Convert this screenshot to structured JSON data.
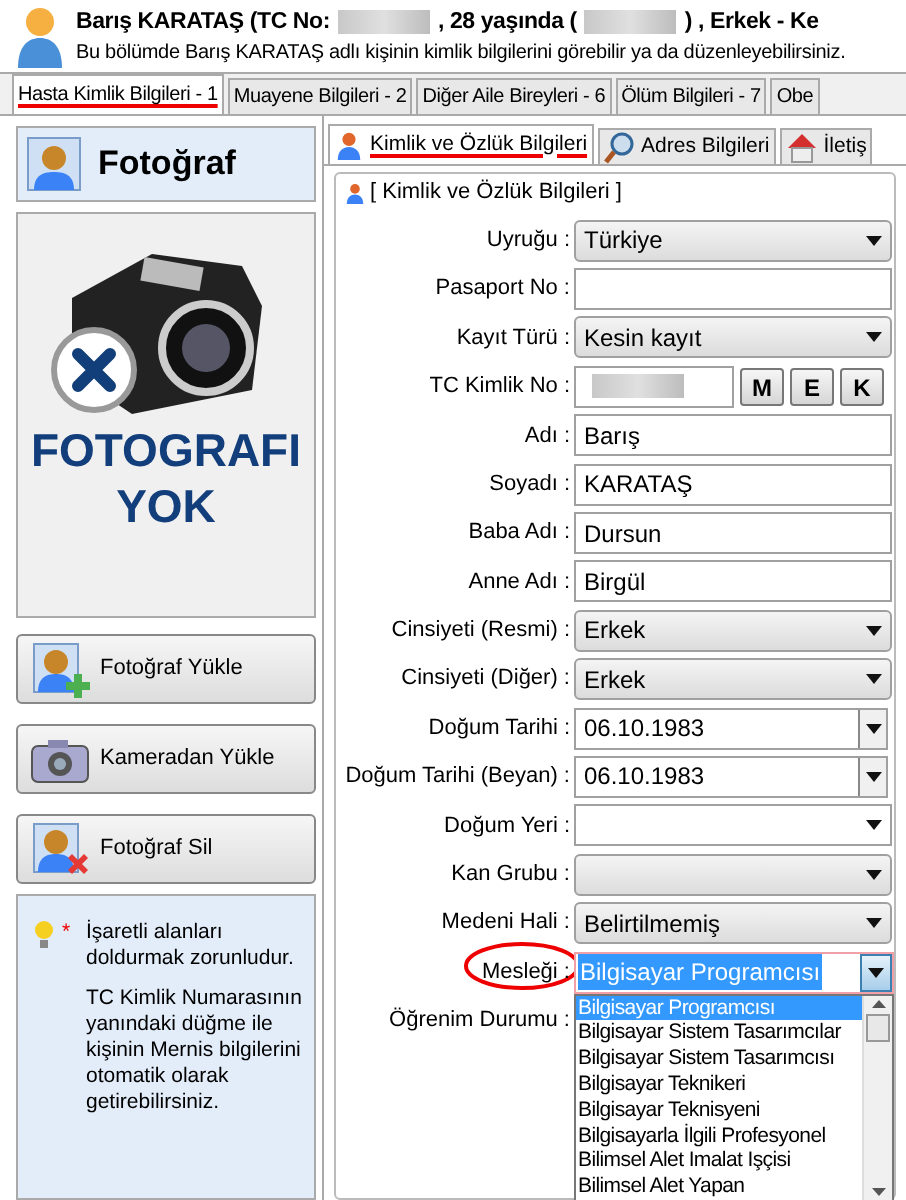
{
  "header": {
    "parts": [
      {
        "kind": "text",
        "text": "Barış KARATAŞ (TC No:"
      },
      {
        "kind": "redacted"
      },
      {
        "kind": "text",
        "text": ", 28 yaşında ("
      },
      {
        "kind": "redacted"
      },
      {
        "kind": "text",
        "text": ") , Erkek - Ke"
      }
    ],
    "subtitle": "Bu bölümde Barış KARATAŞ adlı kişinin kimlik bilgilerini görebilir ya da düzenleyebilirsiniz."
  },
  "tabs": [
    {
      "label": "Hasta Kimlik Bilgileri - 1",
      "selected": true
    },
    {
      "label": "Muayene Bilgileri - 2",
      "selected": false
    },
    {
      "label": "Diğer Aile Bireyleri - 6",
      "selected": false
    },
    {
      "label": "Ölüm Bilgileri - 7",
      "selected": false
    },
    {
      "label": "Obe",
      "selected": false
    }
  ],
  "photo_panel": {
    "title": "Fotoğraf",
    "placeholder_lines": [
      "FOTOGRAFI",
      "YOK"
    ],
    "buttons": [
      {
        "label": "Fotoğraf Yükle",
        "kind": "add"
      },
      {
        "label": "Kameradan Yükle",
        "kind": "camera"
      },
      {
        "label": "Fotoğraf Sil",
        "kind": "delete"
      }
    ],
    "info": {
      "mark": "*",
      "required_note": "İşaretli alanları doldurmak zorunludur.",
      "tip": "TC Kimlik Numarasının yanındaki düğme ile kişinin Mernis bilgilerini otomatik olarak getirebilirsiniz."
    }
  },
  "subtabs": [
    {
      "label": "Kimlik ve Özlük Bilgileri",
      "selected": true,
      "kind": "person"
    },
    {
      "label": "Adres Bilgileri",
      "selected": false,
      "kind": "search"
    },
    {
      "label": "İletiş",
      "selected": false,
      "kind": "home"
    }
  ],
  "group_title": "[ Kimlik ve Özlük Bilgileri ]",
  "fields": [
    {
      "label": "Uyruğu :",
      "kind": "combo",
      "value": "Türkiye"
    },
    {
      "label": "Pasaport No :",
      "kind": "text"
    },
    {
      "label": "Kayıt Türü :",
      "kind": "combo",
      "value": "Kesin kayıt"
    },
    {
      "label": "TC Kimlik No :",
      "kind": "tc",
      "buttons": [
        "M",
        "E",
        "K"
      ]
    },
    {
      "label": "Adı :",
      "kind": "text",
      "value": "Barış"
    },
    {
      "label": "Soyadı :",
      "kind": "text",
      "value": "KARATAŞ"
    },
    {
      "label": "Baba Adı :",
      "kind": "text",
      "value": "Dursun"
    },
    {
      "label": "Anne Adı :",
      "kind": "text",
      "value": "Birgül"
    },
    {
      "label": "Cinsiyeti (Resmi) :",
      "kind": "combo",
      "value": "Erkek"
    },
    {
      "label": "Cinsiyeti (Diğer) :",
      "kind": "combo",
      "value": "Erkek"
    },
    {
      "label": "Doğum Tarihi :",
      "kind": "date",
      "value": "06.10.1983"
    },
    {
      "label": "Doğum Tarihi (Beyan) :",
      "kind": "date",
      "value": "06.10.1983"
    },
    {
      "label": "Doğum Yeri :",
      "kind": "flat"
    },
    {
      "label": "Kan Grubu :",
      "kind": "combo"
    },
    {
      "label": "Medeni Hali :",
      "kind": "combo",
      "value": "Belirtilmemiş"
    },
    {
      "label": "Mesleği :",
      "kind": "open",
      "value": "Bilgisayar Programcısı",
      "circled": true
    },
    {
      "label": "Öğrenim Durumu :",
      "kind": "hidden"
    }
  ],
  "dropdown": [
    {
      "label": "Bilgisayar Programcısı",
      "selected": true
    },
    {
      "label": "Bilgisayar Sistem Tasarımcılar",
      "selected": false
    },
    {
      "label": "Bilgisayar Sistem Tasarımcısı",
      "selected": false
    },
    {
      "label": "Bilgisayar Teknikeri",
      "selected": false
    },
    {
      "label": "Bilgisayar Teknisyeni",
      "selected": false
    },
    {
      "label": "Bilgisayarla İlgili Profesyonel",
      "selected": false
    },
    {
      "label": "Bilimsel Alet Imalat Işçisi",
      "selected": false
    },
    {
      "label": "Bilimsel Alet Yapan",
      "selected": false
    }
  ]
}
